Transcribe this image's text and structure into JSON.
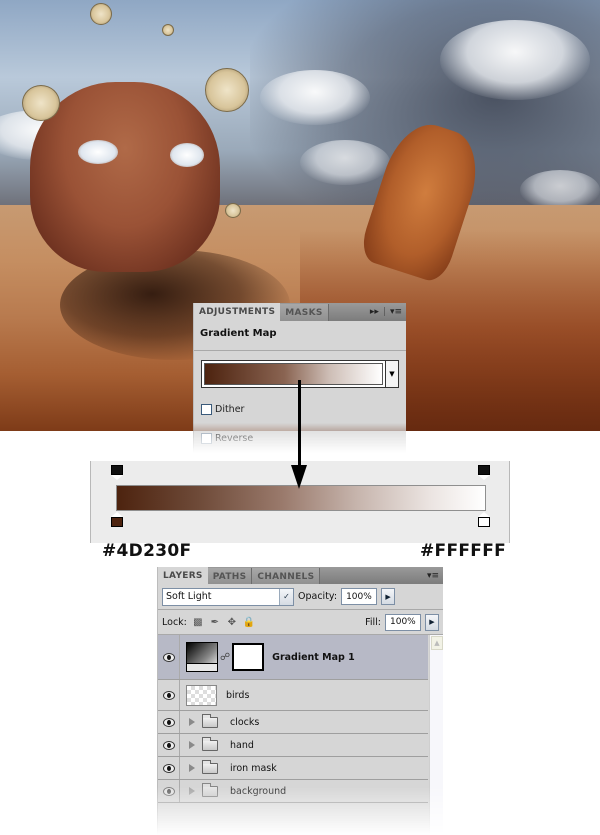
{
  "scene": {
    "description": "Desert photo-manipulation: cracked clay mask face, hand rising from sand, floating clocks, birds"
  },
  "adjustments_panel": {
    "tabs": [
      {
        "label": "ADJUSTMENTS",
        "active": true
      },
      {
        "label": "MASKS",
        "active": false
      }
    ],
    "controls": {
      "expand_icon": "double-arrow-right-icon",
      "menu_icon": "panel-menu-icon"
    },
    "title": "Gradient Map",
    "gradient_start_color": "#4D230F",
    "gradient_end_color": "#FFFFFF",
    "dither_label": "Dither",
    "dither_checked": false,
    "reverse_label": "Reverse",
    "reverse_checked": false
  },
  "gradient_editor": {
    "start_color_label": "#4D230F",
    "end_color_label": "#FFFFFF",
    "start_color": "#4D230F",
    "end_color": "#FFFFFF"
  },
  "layers_panel": {
    "tabs": [
      {
        "label": "LAYERS",
        "active": true
      },
      {
        "label": "PATHS",
        "active": false
      },
      {
        "label": "CHANNELS",
        "active": false
      }
    ],
    "blend_mode": "Soft Light",
    "opacity_label": "Opacity:",
    "opacity_value": "100%",
    "lock_label": "Lock:",
    "fill_label": "Fill:",
    "fill_value": "100%",
    "layers": [
      {
        "name": "Gradient Map 1",
        "type": "adjustment",
        "selected": true,
        "visible": true
      },
      {
        "name": "birds",
        "type": "pixel",
        "selected": false,
        "visible": true
      },
      {
        "name": "clocks",
        "type": "group",
        "selected": false,
        "visible": true
      },
      {
        "name": "hand",
        "type": "group",
        "selected": false,
        "visible": true
      },
      {
        "name": "iron mask",
        "type": "group",
        "selected": false,
        "visible": true
      },
      {
        "name": "background",
        "type": "group",
        "selected": false,
        "visible": true
      }
    ]
  }
}
